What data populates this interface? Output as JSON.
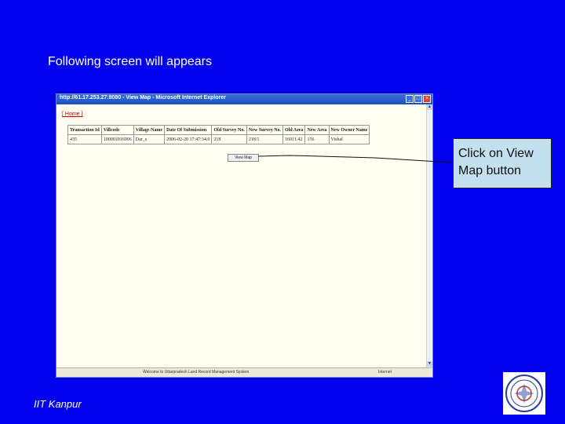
{
  "slide": {
    "title": "Following screen will appears",
    "footer": "IIT Kanpur",
    "callout": "Click on View Map button"
  },
  "browser": {
    "title": "http://61.17.253.27:8080 - View Map - Microsoft Internet Explorer",
    "home_link": "[ Home ]",
    "table": {
      "headers": [
        "Transaction Id",
        "Villcode",
        "Village Name",
        "Date Of Submission",
        "Old Survey No.",
        "New Survey No.",
        "Old Area",
        "New Area",
        "New Owner Name"
      ],
      "rows": [
        [
          "435",
          "100001016906",
          "Dar_s",
          "2006-02-20 17:47:34.0",
          "218",
          "218/1",
          "16011.42",
          "156",
          "Vishal"
        ]
      ]
    },
    "view_map_button": "View Map",
    "status_text": "Welcome to Uttarpradesh Land Record Management System",
    "zone_text": "Internet"
  },
  "colors": {
    "background": "#0000ee",
    "callout": "#c2e0ee"
  }
}
